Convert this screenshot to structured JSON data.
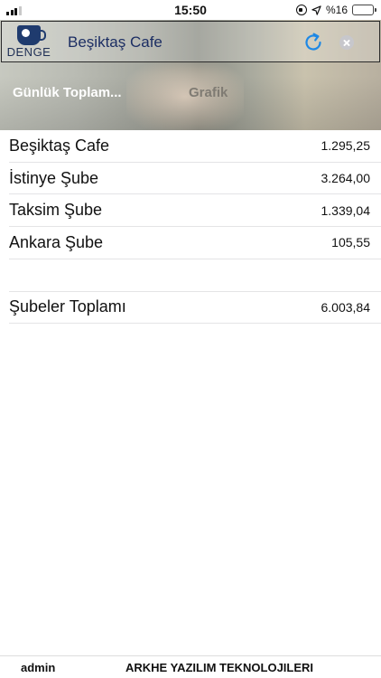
{
  "status_bar": {
    "time": "15:50",
    "battery_text": "%16",
    "icons": [
      "signal-icon",
      "orientation-lock-icon",
      "location-arrow-icon",
      "battery-icon"
    ]
  },
  "header": {
    "logo_text": "DENGE",
    "title": "Beşiktaş Cafe",
    "refresh_icon": "refresh-icon",
    "close_icon": "close-icon",
    "tabs": [
      {
        "label": "Günlük Toplam...",
        "active": true
      },
      {
        "label": "Grafik",
        "active": false
      }
    ]
  },
  "rows": [
    {
      "name": "Beşiktaş Cafe",
      "value": "1.295,25"
    },
    {
      "name": "İstinye Şube",
      "value": "3.264,00"
    },
    {
      "name": "Taksim Şube",
      "value": "1.339,04"
    },
    {
      "name": "Ankara Şube",
      "value": "105,55"
    }
  ],
  "total": {
    "name": "Şubeler Toplamı",
    "value": "6.003,84"
  },
  "footer": {
    "user": "admin",
    "company": "ARKHE YAZILIM TEKNOLOJILERI"
  },
  "colors": {
    "accent": "#1e88e5",
    "title": "#1c2e63",
    "battery": "#f2c200"
  }
}
